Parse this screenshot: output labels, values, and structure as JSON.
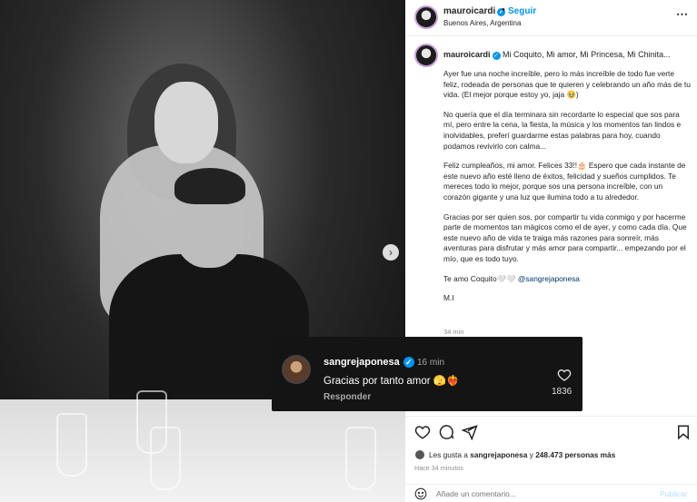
{
  "post": {
    "username": "mauroicardi",
    "verified_mark": "✓",
    "separator": "•",
    "follow_label": "Seguir",
    "location": "Buenos Aires, Argentina",
    "more_icon": "⋯",
    "carousel_next": "›"
  },
  "caption": {
    "username": "mauroicardi",
    "first_line": "Mi Coquito, Mi amor, Mi Princesa, Mi Chinita...",
    "paragraphs": [
      "Ayer fue una noche increíble, pero lo más increíble de todo fue verte feliz, rodeada de personas que te quieren y celebrando un año más de tu vida. (El mejor porque estoy yo, jaja 🥹)",
      "No quería que el día terminara sin recordarte lo especial que sos para mí, pero entre la cena, la fiesta, la música y los momentos tan lindos e inolvidables, preferí guardarme estas palabras para hoy, cuando podamos revivirlo con calma...",
      "Feliz cumpleaños, mi amor. Felices 33!!🎂 Espero que cada instante de este nuevo año esté lleno de éxitos, felicidad y sueños cumplidos. Te mereces todo lo mejor, porque sos una persona increíble, con un corazón gigante y una luz que ilumina todo a tu alrededor.",
      "Gracias por ser quien sos, por compartir tu vida conmigo y por hacerme parte de momentos tan mágicos como el de ayer, y como cada día. Que este nuevo año de vida te traiga más razones para sonreír, más aventuras para disfrutar y más amor para compartir... empezando por el mío, que es todo tuyo."
    ],
    "love_line": "Te amo Coquito🤍🤍",
    "mention": "@sangrejaponesa",
    "signature": "M.I",
    "time": "34 min"
  },
  "actions": {
    "likes_prefix": "Les gusta a",
    "likes_user": "sangrejaponesa",
    "likes_middle": "y",
    "likes_count": "248.473 personas más",
    "posted_ago": "Hace 34 minutos"
  },
  "comment_box": {
    "placeholder": "Añade un comentario...",
    "publish_label": "Publicar"
  },
  "highlight_comment": {
    "username": "sangrejaponesa",
    "verified_mark": "✓",
    "time": "16 min",
    "text": "Gracias por tanto amor 🫣❤️‍🔥",
    "reply_label": "Responder",
    "likes": "1836"
  },
  "icons": {
    "heart": "heart-icon",
    "comment": "comment-icon",
    "share": "share-icon",
    "save": "bookmark-icon",
    "emoji": "emoji-icon"
  },
  "colors": {
    "accent": "#0095f6",
    "card_bg": "#141414",
    "muted": "#8e8e8e"
  }
}
